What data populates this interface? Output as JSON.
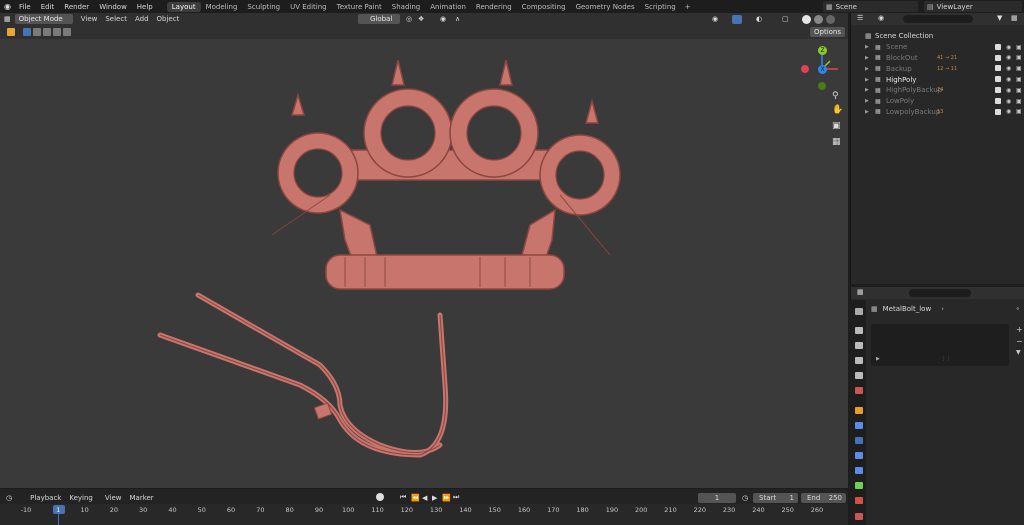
{
  "menu": [
    "File",
    "Edit",
    "Render",
    "Window",
    "Help"
  ],
  "workspaces": [
    {
      "label": "Layout",
      "active": true
    },
    {
      "label": "Modeling",
      "active": false
    },
    {
      "label": "Sculpting",
      "active": false
    },
    {
      "label": "UV Editing",
      "active": false
    },
    {
      "label": "Texture Paint",
      "active": false
    },
    {
      "label": "Shading",
      "active": false
    },
    {
      "label": "Animation",
      "active": false
    },
    {
      "label": "Rendering",
      "active": false
    },
    {
      "label": "Compositing",
      "active": false
    },
    {
      "label": "Geometry Nodes",
      "active": false
    },
    {
      "label": "Scripting",
      "active": false
    }
  ],
  "add_workspace": "+",
  "scene": "Scene",
  "view_layer": "ViewLayer",
  "viewport_header": {
    "mode": "Object Mode",
    "menus": [
      "View",
      "Select",
      "Add",
      "Object"
    ],
    "transform": "Global",
    "options": "Options"
  },
  "gizmo": {
    "z": "Z",
    "y": "Y",
    "x": "X"
  },
  "outliner": {
    "collection": "Scene Collection",
    "items": [
      {
        "name": "Scene",
        "dim": true
      },
      {
        "name": "BlockOut",
        "dim": true,
        "count": "41 → 21"
      },
      {
        "name": "Backup",
        "dim": true,
        "count": "12 → 11"
      },
      {
        "name": "HighPoly",
        "dim": false
      },
      {
        "name": "HighPolyBackup",
        "dim": true,
        "count": "24"
      },
      {
        "name": "LowPoly",
        "dim": true
      },
      {
        "name": "LowpolyBackup",
        "dim": true,
        "count": "13"
      }
    ]
  },
  "properties": {
    "object": "MetalBolt_low",
    "chevron": "›"
  },
  "timeline": {
    "menus": [
      "Playback",
      "Keying",
      "View",
      "Marker"
    ],
    "current_frame": "1",
    "start_label": "Start",
    "start": "1",
    "end_label": "End",
    "end": "250",
    "ticks": [
      "-10",
      "1",
      "10",
      "20",
      "30",
      "40",
      "50",
      "60",
      "70",
      "80",
      "90",
      "100",
      "110",
      "120",
      "130",
      "140",
      "150",
      "160",
      "170",
      "180",
      "190",
      "200",
      "210",
      "220",
      "230",
      "240",
      "250",
      "260"
    ]
  },
  "colors": {
    "accent": "#4772b3",
    "model": "#c8756d",
    "model_dark": "#8a4640",
    "x_axis": "#e2434f",
    "y_axis": "#8fcc23",
    "z_axis": "#2d86f2"
  }
}
